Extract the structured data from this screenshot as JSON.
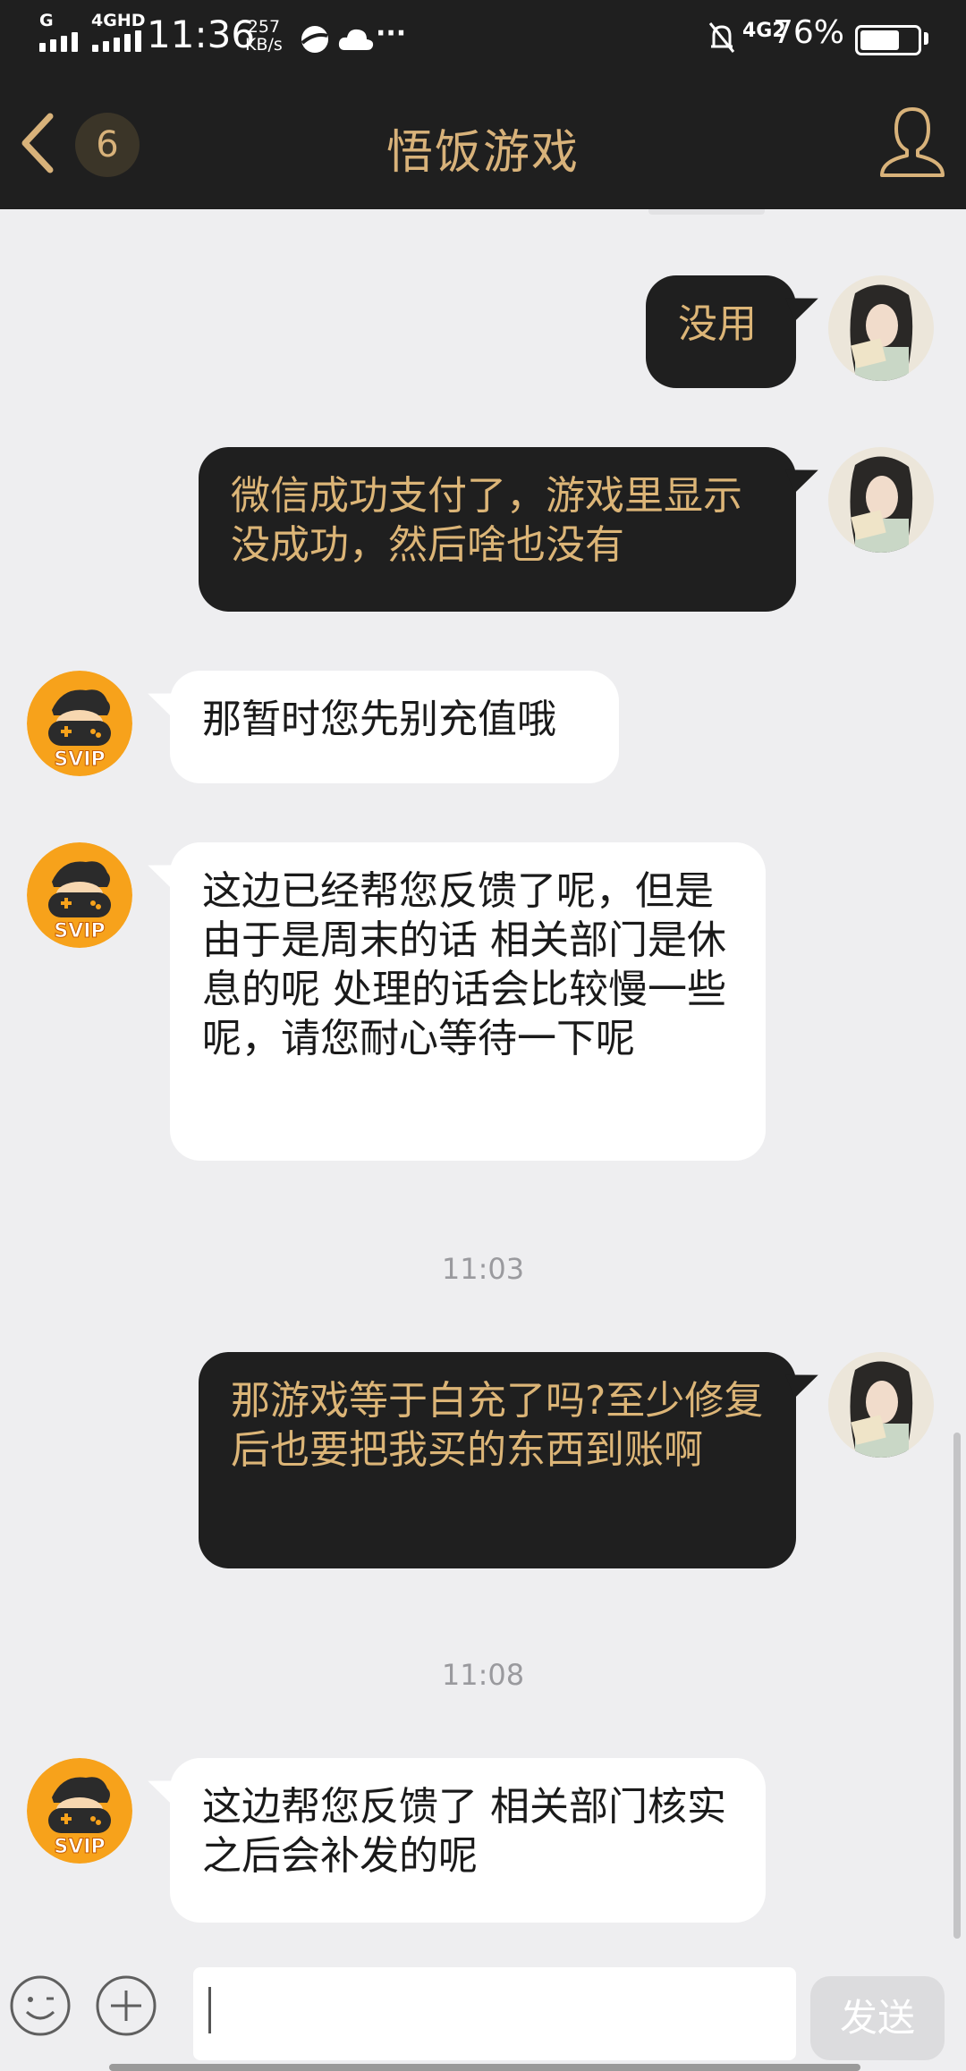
{
  "status_bar": {
    "network_1": "G",
    "network_2": "4GHD",
    "time": "11:36",
    "speed_value": "257",
    "speed_unit": "KB/s",
    "more": "···",
    "network_right": "4G2",
    "battery": "76%",
    "battery_level": 0.76,
    "icons": [
      "browser-icon",
      "cloud-icon",
      "mute-icon"
    ]
  },
  "header": {
    "unread_count": "6",
    "title": "悟饭游戏",
    "icons": [
      "back-chevron-icon",
      "profile-icon"
    ]
  },
  "messages": [
    {
      "sender": "me",
      "text": "没用"
    },
    {
      "sender": "me",
      "text": "微信成功支付了，游戏里显示没成功，然后啥也没有"
    },
    {
      "sender": "service",
      "text": "那暂时您先别充值哦"
    },
    {
      "sender": "service",
      "text": "这边已经帮您反馈了呢，但是由于是周末的话 相关部门是休息的呢 处理的话会比较慢一些呢，请您耐心等待一下呢"
    },
    {
      "sender": "me",
      "text": "那游戏等于白充了吗?至少修复后也要把我买的东西到账啊"
    },
    {
      "sender": "service",
      "text": "这边帮您反馈了 相关部门核实之后会补发的呢"
    }
  ],
  "timestamps": [
    "11:03",
    "11:08"
  ],
  "service_badge": "SVIP",
  "input": {
    "value": "",
    "placeholder": "",
    "send_label": "发送",
    "icons": [
      "emoji-icon",
      "plus-icon"
    ]
  },
  "colors": {
    "header_bg": "#1f1f1f",
    "accent_gold": "#d8b27a",
    "my_bubble": "#1f1f1f",
    "my_text": "#dcb577",
    "service_bubble": "#ffffff",
    "chat_bg": "#eeeef0"
  }
}
